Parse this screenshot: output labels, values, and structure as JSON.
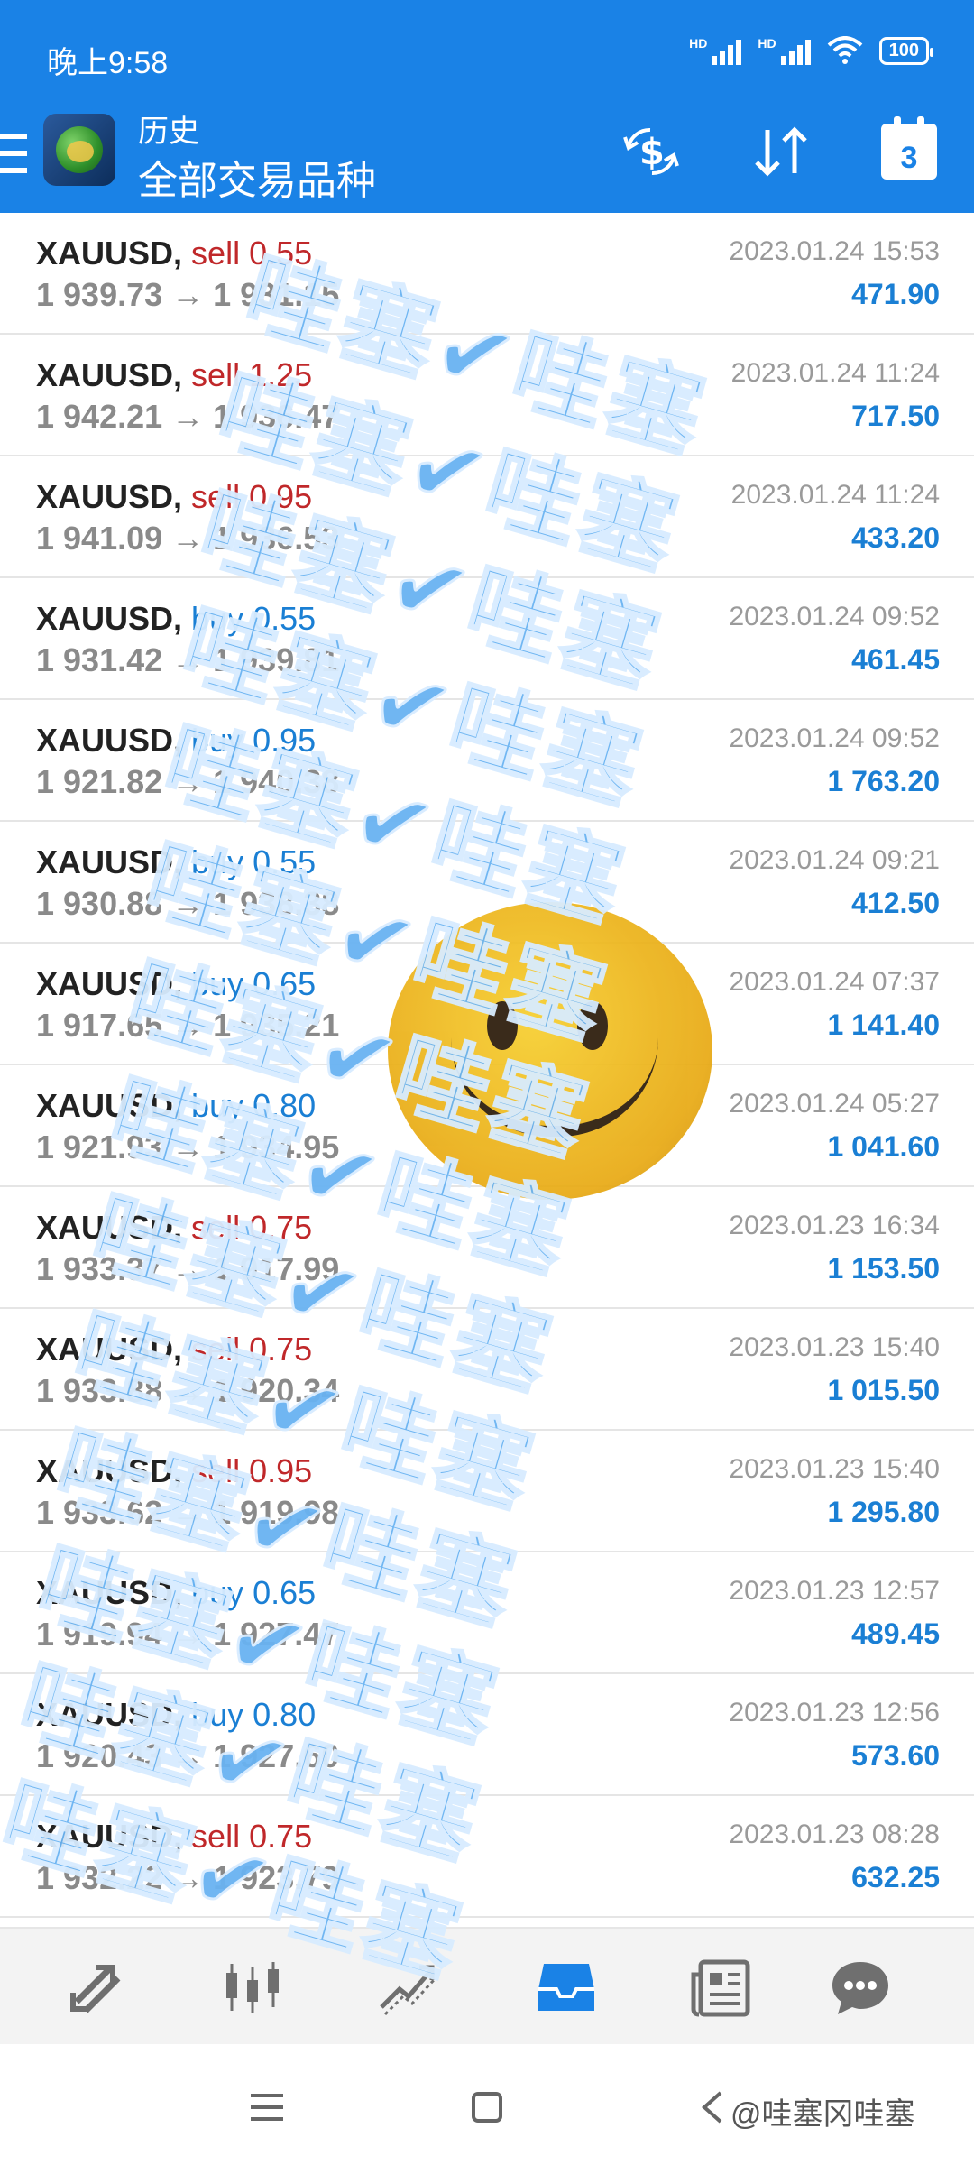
{
  "status_bar": {
    "time": "晚上9:58",
    "hd1": "HD",
    "hd2": "HD",
    "battery": "100"
  },
  "app_bar": {
    "subtitle": "历史",
    "title": "全部交易品种",
    "calendar_day": "3",
    "colors": {
      "primary": "#1a82e6"
    },
    "icons": [
      "menu-icon",
      "app-logo",
      "currency-exchange-icon",
      "sort-icon",
      "calendar-icon"
    ]
  },
  "deals": [
    {
      "symbol": "XAUUSD,",
      "side": "sell",
      "volume": "sell 0.55",
      "prices": "1 939.73 → 1 931.15",
      "time": "2023.01.24 15:53",
      "profit": "471.90"
    },
    {
      "symbol": "XAUUSD,",
      "side": "sell",
      "volume": "sell 1.25",
      "prices": "1 942.21 → 1 936.47",
      "time": "2023.01.24 11:24",
      "profit": "717.50"
    },
    {
      "symbol": "XAUUSD,",
      "side": "sell",
      "volume": "sell 0.95",
      "prices": "1 941.09 → 1 936.53",
      "time": "2023.01.24 11:24",
      "profit": "433.20"
    },
    {
      "symbol": "XAUUSD,",
      "side": "buy",
      "volume": "buy 0.55",
      "prices": "1 931.42 → 1 939.81",
      "time": "2023.01.24 09:52",
      "profit": "461.45"
    },
    {
      "symbol": "XAUUSD,",
      "side": "buy",
      "volume": "buy 0.95",
      "prices": "1 921.82 → 1 940.38",
      "time": "2023.01.24 09:52",
      "profit": "1 763.20"
    },
    {
      "symbol": "XAUUSD,",
      "side": "buy",
      "volume": "buy 0.55",
      "prices": "1 930.88 → 1 938.38",
      "time": "2023.01.24 09:21",
      "profit": "412.50"
    },
    {
      "symbol": "XAUUSD,",
      "side": "buy",
      "volume": "buy 0.65",
      "prices": "1 917.65 → 1 935.21",
      "time": "2023.01.24 07:37",
      "profit": "1 141.40"
    },
    {
      "symbol": "XAUUSD,",
      "side": "buy",
      "volume": "buy 0.80",
      "prices": "1 921.93 → 1 934.95",
      "time": "2023.01.24 05:27",
      "profit": "1 041.60"
    },
    {
      "symbol": "XAUUSD,",
      "side": "sell",
      "volume": "sell 0.75",
      "prices": "1 933.37 → 1 917.99",
      "time": "2023.01.23 16:34",
      "profit": "1 153.50"
    },
    {
      "symbol": "XAUUSD,",
      "side": "sell",
      "volume": "sell 0.75",
      "prices": "1 933.88 → 1 920.34",
      "time": "2023.01.23 15:40",
      "profit": "1 015.50"
    },
    {
      "symbol": "XAUUSD,",
      "side": "sell",
      "volume": "sell 0.95",
      "prices": "1 933.62 → 1 919.98",
      "time": "2023.01.23 15:40",
      "profit": "1 295.80"
    },
    {
      "symbol": "XAUUSD,",
      "side": "buy",
      "volume": "buy 0.65",
      "prices": "1 919.94 → 1 927.47",
      "time": "2023.01.23 12:57",
      "profit": "489.45"
    },
    {
      "symbol": "XAUUSD,",
      "side": "buy",
      "volume": "buy 0.80",
      "prices": "1 920.43 → 1 927.60",
      "time": "2023.01.23 12:56",
      "profit": "573.60"
    },
    {
      "symbol": "XAUUSD,",
      "side": "sell",
      "volume": "sell 0.75",
      "prices": "1 932.22 → 1 923.79",
      "time": "2023.01.23 08:28",
      "profit": "632.25"
    }
  ],
  "deal_colors": {
    "sell": "#c0282a",
    "buy": "#1a7fd4",
    "profit": "#1a7fd4"
  },
  "bottom_nav": {
    "items": [
      "quotes-icon",
      "chart-icon",
      "trade-icon",
      "history-icon",
      "news-icon",
      "messages-icon"
    ],
    "active": "history-icon"
  },
  "system_nav": {
    "watermark": "@哇塞冈哇塞"
  },
  "overlay": {
    "watermark_text": "哇塞✔哇塞",
    "watermark_color": "#69b3f2"
  }
}
